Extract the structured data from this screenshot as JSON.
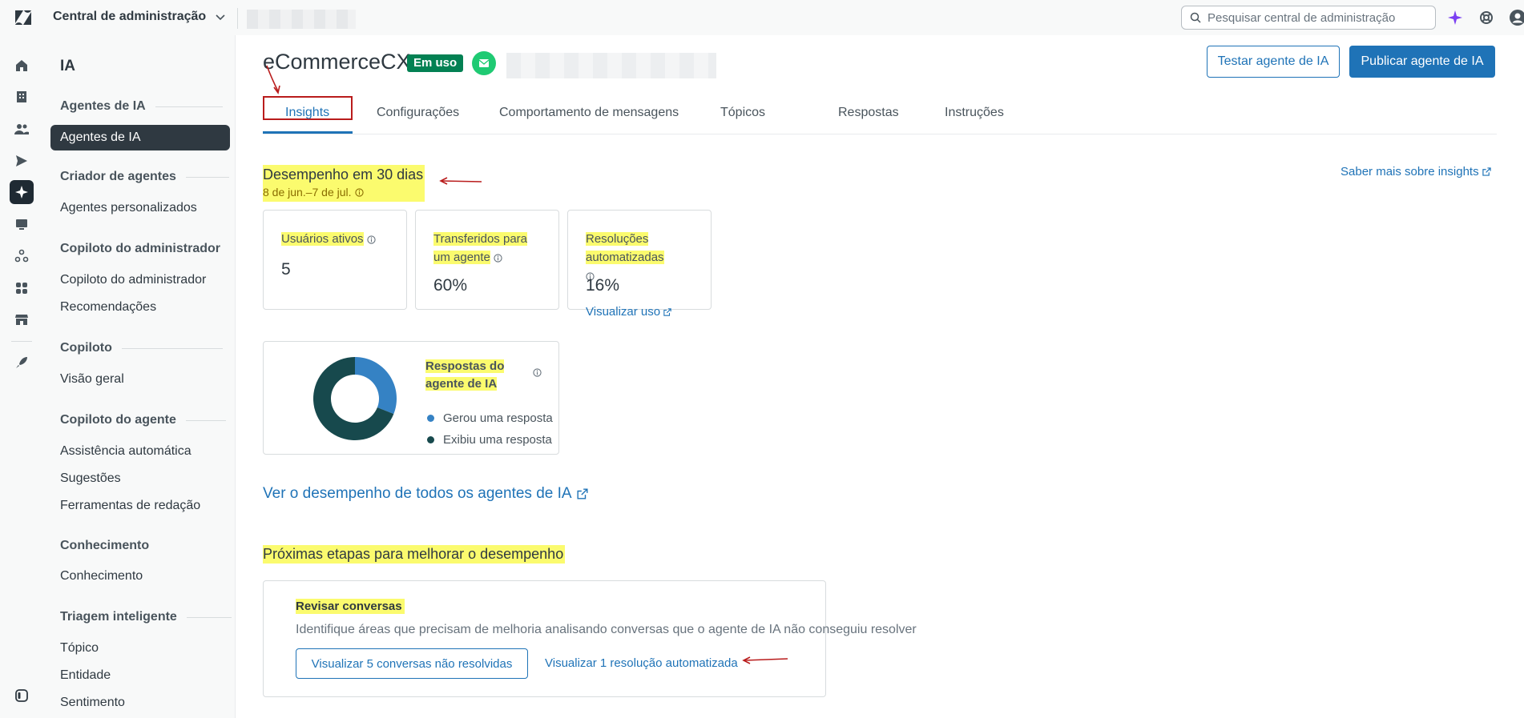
{
  "topbar": {
    "product_name": "Central de administração",
    "search_placeholder": "Pesquisar central de administração"
  },
  "nav": {
    "title": "IA",
    "sections": [
      {
        "heading": "Agentes de IA",
        "items": [
          "Agentes de IA"
        ]
      },
      {
        "heading": "Criador de agentes",
        "items": [
          "Agentes personalizados"
        ]
      },
      {
        "heading": "Copiloto do administrador",
        "items": [
          "Copiloto do administrador",
          "Recomendações"
        ]
      },
      {
        "heading": "Copiloto",
        "items": [
          "Visão geral"
        ]
      },
      {
        "heading": "Copiloto do agente",
        "items": [
          "Assistência automática",
          "Sugestões",
          "Ferramentas de redação"
        ]
      },
      {
        "heading": "Conhecimento",
        "items": [
          "Conhecimento"
        ]
      },
      {
        "heading": "Triagem inteligente",
        "items": [
          "Tópico",
          "Entidade",
          "Sentimento"
        ]
      }
    ]
  },
  "agent": {
    "name": "eCommerceCX",
    "status": "Em uso",
    "test_button": "Testar agente de IA",
    "publish_button": "Publicar agente de IA"
  },
  "tabs": [
    "Insights",
    "Configurações",
    "Comportamento de mensagens",
    "Tópicos",
    "Respostas",
    "Instruções"
  ],
  "performance": {
    "title": "Desempenho em 30 dias",
    "date_range": "8 de jun.–7 de jul.",
    "learn_more": "Saber mais sobre insights",
    "cards": [
      {
        "label": "Usuários ativos",
        "value": "5"
      },
      {
        "label": "Transferidos para um agente",
        "value": "60%"
      },
      {
        "label": "Resoluções automatizadas",
        "value": "16%",
        "link": "Visualizar uso"
      }
    ],
    "donut": {
      "title": "Respostas do agente de IA",
      "legend": [
        "Gerou uma resposta",
        "Exibiu uma resposta"
      ]
    },
    "all_agents_link": "Ver o desempenho de todos os agentes de IA"
  },
  "chart_data": {
    "type": "pie",
    "categories": [
      "Gerou uma resposta",
      "Exibiu uma resposta"
    ],
    "values": [
      31,
      69
    ],
    "colors": [
      "#3582c4",
      "#17494d"
    ]
  },
  "next_steps": {
    "title": "Próximas etapas para melhorar o desempenho",
    "card_title": "Revisar conversas",
    "card_desc": "Identifique áreas que precisam de melhoria analisando conversas que o agente de IA não conseguiu resolver",
    "unresolved_button": "Visualizar 5 conversas não resolvidas",
    "resolved_link": "Visualizar 1 resolução automatizada"
  },
  "colors": {
    "accent": "#1f73b7",
    "success": "#038153",
    "highlight": "#fbfb6e",
    "annotation": "#b91c1c"
  }
}
